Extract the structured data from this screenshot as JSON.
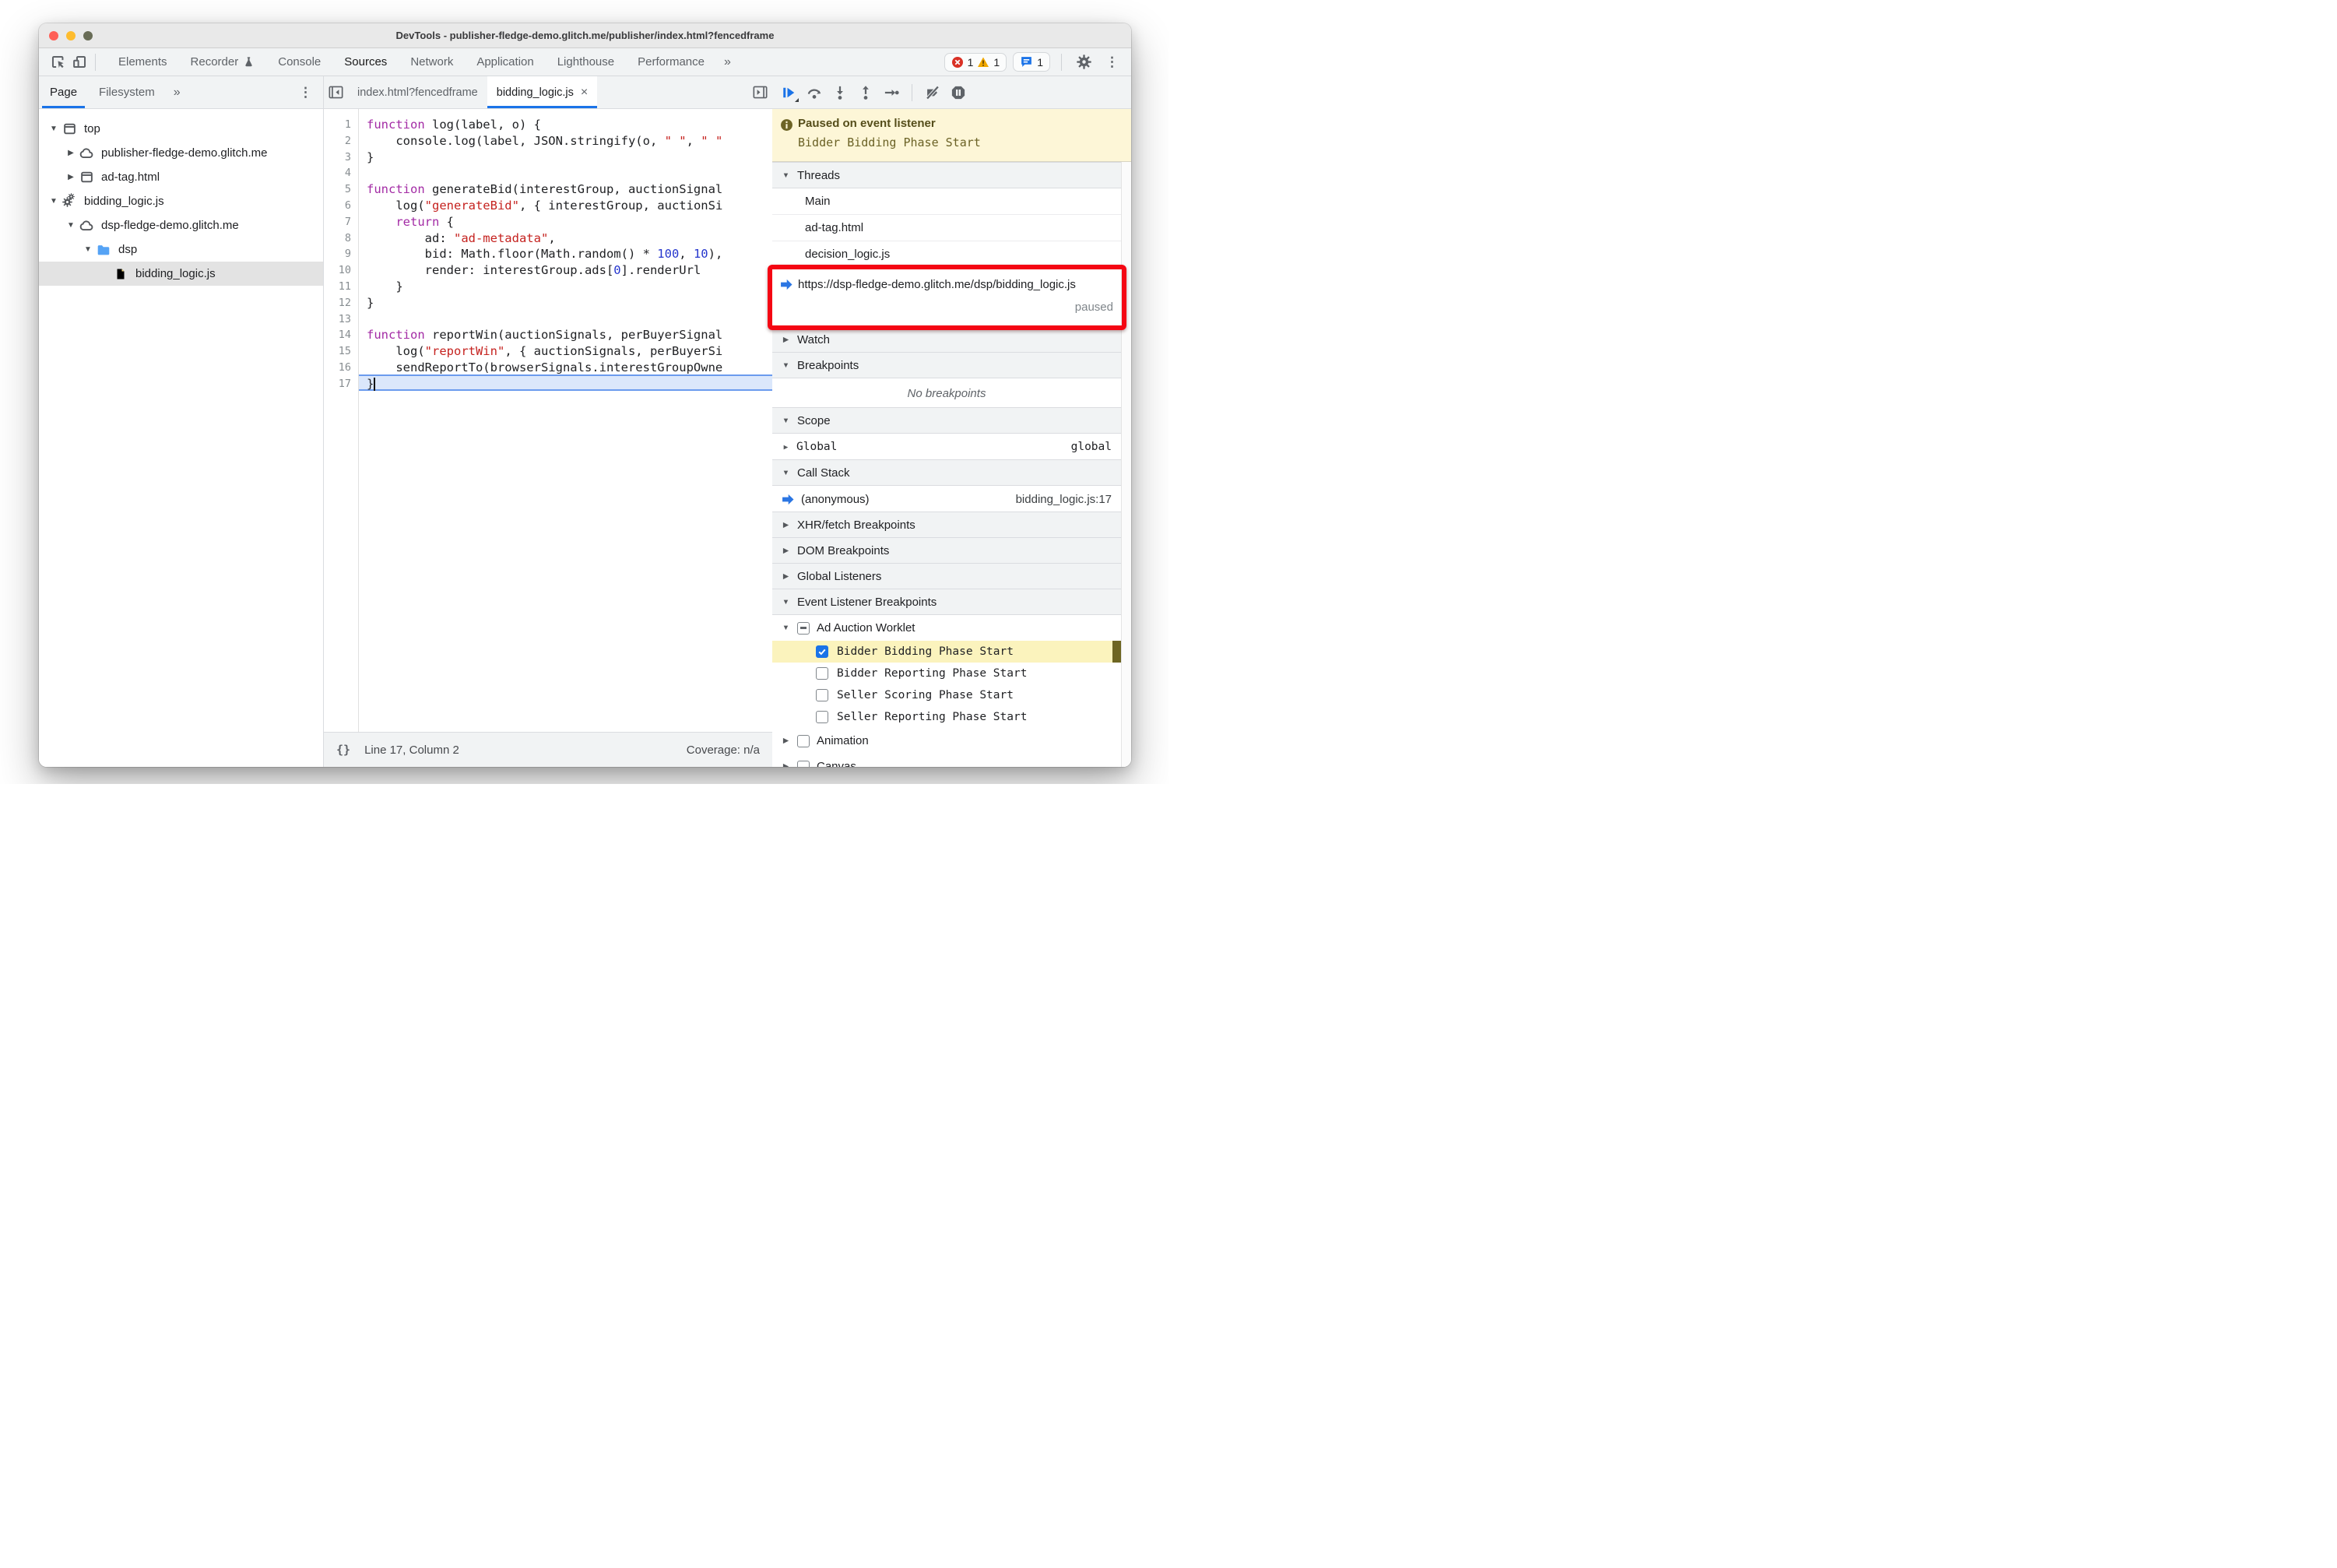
{
  "window": {
    "title": "DevTools - publisher-fledge-demo.glitch.me/publisher/index.html?fencedframe"
  },
  "glyphs": {
    "overflow": "»",
    "menu": "⋮",
    "close": "×",
    "pretty_print": "{}",
    "tri_down": "▼",
    "tri_right": "▶"
  },
  "toolbar": {
    "left_icons": [
      "inspect",
      "devices"
    ],
    "tabs": [
      {
        "label": "Elements"
      },
      {
        "label": "Recorder",
        "flask": true
      },
      {
        "label": "Console"
      },
      {
        "label": "Sources",
        "active": true
      },
      {
        "label": "Network"
      },
      {
        "label": "Application"
      },
      {
        "label": "Lighthouse"
      },
      {
        "label": "Performance"
      }
    ],
    "badges": {
      "errors": "1",
      "warnings": "1",
      "issues": "1"
    }
  },
  "sidebar": {
    "tabs": [
      {
        "label": "Page",
        "active": true
      },
      {
        "label": "Filesystem"
      }
    ],
    "tree": [
      {
        "label": "top",
        "icon": "frame",
        "arrow": "down",
        "depth": 0
      },
      {
        "label": "publisher-fledge-demo.glitch.me",
        "icon": "cloud",
        "arrow": "right",
        "depth": 1
      },
      {
        "label": "ad-tag.html",
        "icon": "frame",
        "arrow": "right",
        "depth": 1
      },
      {
        "label": "bidding_logic.js",
        "icon": "worklet",
        "arrow": "down",
        "depth": 0
      },
      {
        "label": "dsp-fledge-demo.glitch.me",
        "icon": "cloud",
        "arrow": "down",
        "depth": 1
      },
      {
        "label": "dsp",
        "icon": "folder",
        "arrow": "down",
        "depth": 2
      },
      {
        "label": "bidding_logic.js",
        "icon": "file",
        "arrow": "none",
        "depth": 3,
        "selected": true
      }
    ]
  },
  "editor": {
    "tabs": [
      {
        "label": "index.html?fencedframe"
      },
      {
        "label": "bidding_logic.js",
        "active": true,
        "closable": true
      }
    ],
    "active_line": 17,
    "cursor_column": 2,
    "lines": [
      [
        [
          "k",
          "function"
        ],
        [
          "p",
          " log(label, o) {"
        ]
      ],
      [
        [
          "p",
          "    console.log(label, JSON.stringify(o, "
        ],
        [
          "s",
          "\" \""
        ],
        [
          "p",
          ", "
        ],
        [
          "s",
          "\" \""
        ]
      ],
      [
        [
          "p",
          "}"
        ]
      ],
      [],
      [
        [
          "k",
          "function"
        ],
        [
          "p",
          " generateBid(interestGroup, auctionSignal"
        ]
      ],
      [
        [
          "p",
          "    log("
        ],
        [
          "s",
          "\"generateBid\""
        ],
        [
          "p",
          ", { interestGroup, auctionSi"
        ]
      ],
      [
        [
          "p",
          "    "
        ],
        [
          "k",
          "return"
        ],
        [
          "p",
          " {"
        ]
      ],
      [
        [
          "p",
          "        ad: "
        ],
        [
          "s",
          "\"ad-metadata\""
        ],
        [
          "p",
          ","
        ]
      ],
      [
        [
          "p",
          "        bid: Math.floor(Math.random() * "
        ],
        [
          "n",
          "100"
        ],
        [
          "p",
          ", "
        ],
        [
          "n",
          "10"
        ],
        [
          "p",
          "),"
        ]
      ],
      [
        [
          "p",
          "        render: interestGroup.ads["
        ],
        [
          "n",
          "0"
        ],
        [
          "p",
          "].renderUrl"
        ]
      ],
      [
        [
          "p",
          "    }"
        ]
      ],
      [
        [
          "p",
          "}"
        ]
      ],
      [],
      [
        [
          "k",
          "function"
        ],
        [
          "p",
          " reportWin(auctionSignals, perBuyerSignal"
        ]
      ],
      [
        [
          "p",
          "    log("
        ],
        [
          "s",
          "\"reportWin\""
        ],
        [
          "p",
          ", { auctionSignals, perBuyerSi"
        ]
      ],
      [
        [
          "p",
          "    sendReportTo(browserSignals.interestGroupOwne"
        ]
      ],
      [
        [
          "p",
          "}"
        ]
      ]
    ],
    "status": {
      "position": "Line 17, Column 2",
      "coverage": "Coverage: n/a"
    }
  },
  "debugger": {
    "toolbar_icons": [
      "resume",
      "step-over",
      "step-into",
      "step-out",
      "step",
      "separator",
      "deactivate-breakpoints",
      "pause-on-exceptions"
    ],
    "paused": {
      "title": "Paused on event listener",
      "detail": "Bidder Bidding Phase Start"
    },
    "rows": [
      {
        "kind": "header",
        "label": "Threads",
        "arrow": "down"
      },
      {
        "kind": "thread",
        "label": "Main"
      },
      {
        "kind": "thread",
        "label": "ad-tag.html"
      },
      {
        "kind": "thread",
        "label": "decision_logic.js"
      },
      {
        "kind": "thread_current",
        "label": "https://dsp-fledge-demo.glitch.me/dsp/bidding_logic.js",
        "status": "paused",
        "annotated": true
      },
      {
        "kind": "header",
        "label": "Watch",
        "arrow": "right"
      },
      {
        "kind": "header",
        "label": "Breakpoints",
        "arrow": "down"
      },
      {
        "kind": "empty",
        "label": "No breakpoints"
      },
      {
        "kind": "header",
        "label": "Scope",
        "arrow": "down"
      },
      {
        "kind": "scope",
        "name": "Global",
        "value": "global"
      },
      {
        "kind": "header",
        "label": "Call Stack",
        "arrow": "down"
      },
      {
        "kind": "frame",
        "name": "(anonymous)",
        "location": "bidding_logic.js:17"
      },
      {
        "kind": "header",
        "label": "XHR/fetch Breakpoints",
        "arrow": "right"
      },
      {
        "kind": "header",
        "label": "DOM Breakpoints",
        "arrow": "right"
      },
      {
        "kind": "header",
        "label": "Global Listeners",
        "arrow": "right"
      },
      {
        "kind": "header",
        "label": "Event Listener Breakpoints",
        "arrow": "down"
      },
      {
        "kind": "category",
        "label": "Ad Auction Worklet",
        "arrow": "down",
        "checkbox": "indeterminate"
      },
      {
        "kind": "check_item",
        "label": "Bidder Bidding Phase Start",
        "checked": true,
        "highlighted": true
      },
      {
        "kind": "check_item",
        "label": "Bidder Reporting Phase Start",
        "checked": false
      },
      {
        "kind": "check_item",
        "label": "Seller Scoring Phase Start",
        "checked": false
      },
      {
        "kind": "check_item",
        "label": "Seller Reporting Phase Start",
        "checked": false
      },
      {
        "kind": "category",
        "label": "Animation",
        "arrow": "right",
        "checkbox": "unchecked"
      },
      {
        "kind": "category",
        "label": "Canvas",
        "arrow": "right",
        "checkbox": "unchecked"
      }
    ]
  },
  "annotation": {
    "type": "red-box-highlight",
    "target": "paused worklet thread row"
  },
  "colors": {
    "accent_blue": "#1a73e8",
    "paused_banner_bg": "#fdf6d7",
    "paused_banner_text": "#6b6226",
    "annotation_red": "#f40613",
    "error_red": "#d93025",
    "warning_amber": "#f0a800",
    "issue_blue": "#1a73e8",
    "selected_row_gray": "#e3e3e3",
    "breakpoint_highlight_yellow": "#fbf3bd",
    "code_keyword": "#a32ba5",
    "code_string": "#c5221f",
    "code_number": "#2536cd",
    "traffic_red": "#ff5f57",
    "traffic_yellow": "#febc2e",
    "traffic_gray": "#686c56"
  }
}
